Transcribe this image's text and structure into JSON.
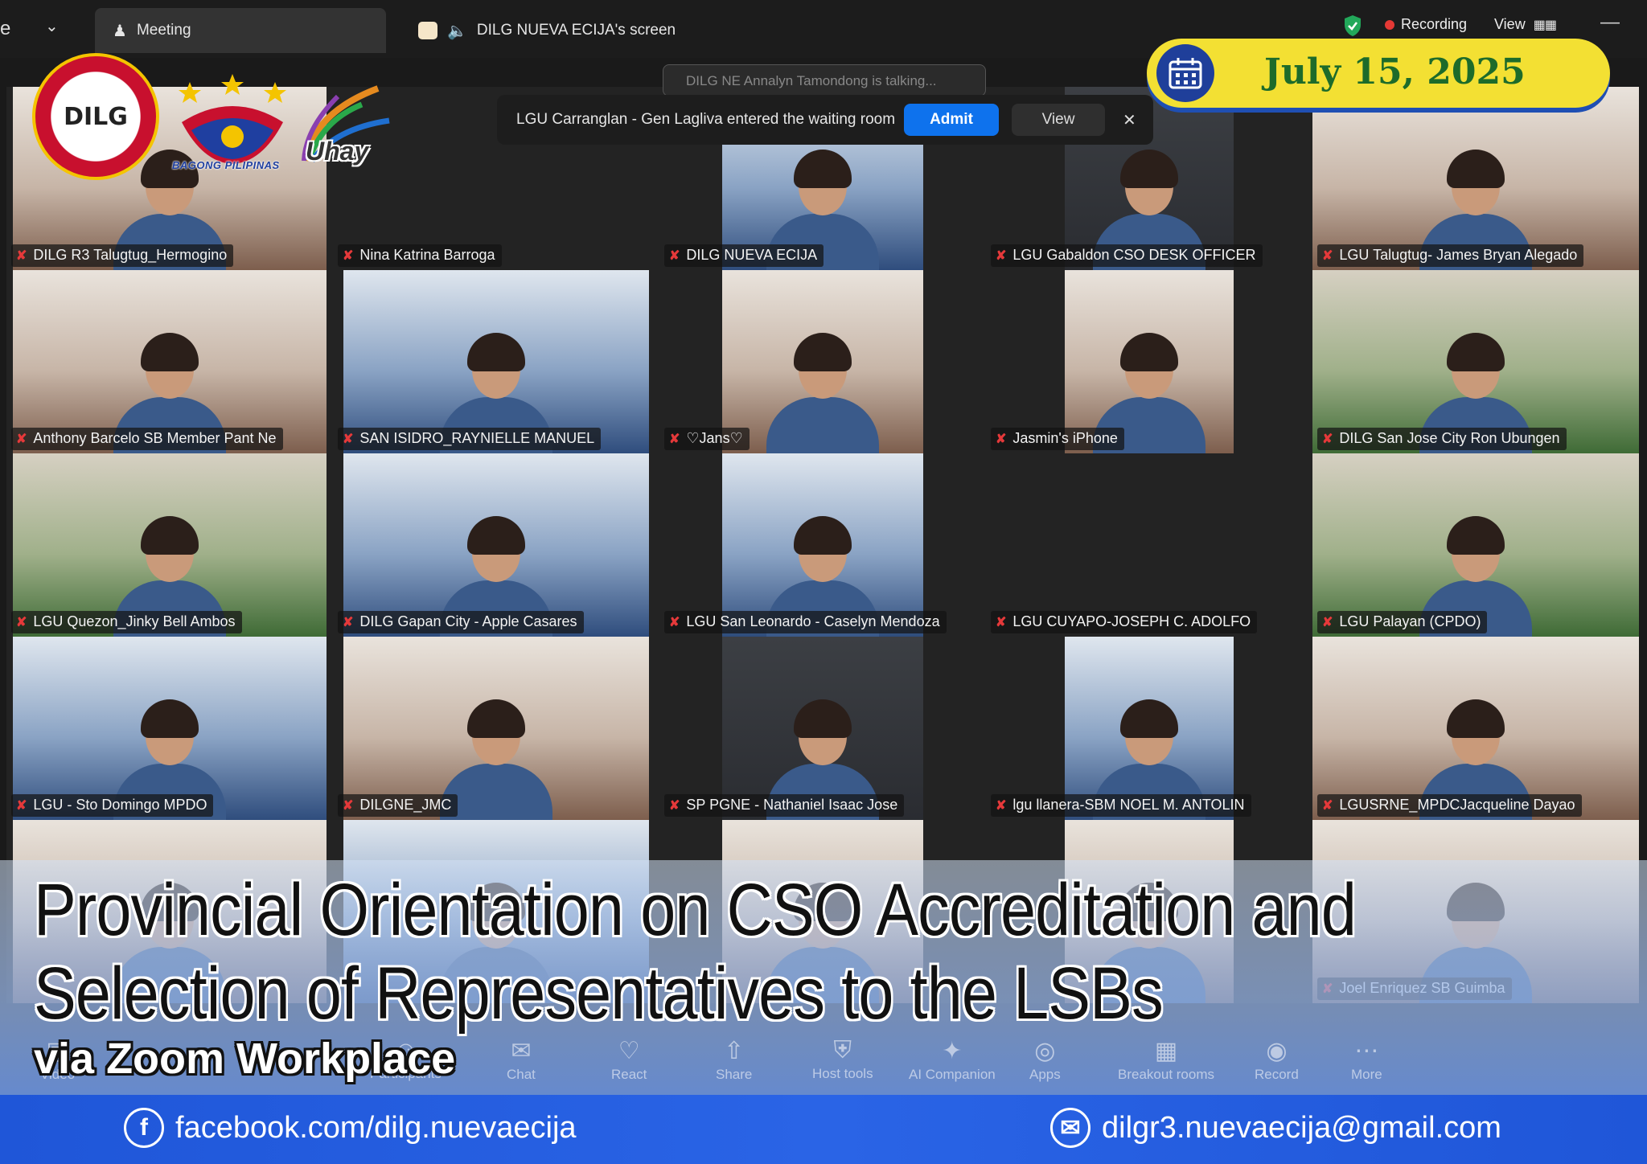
{
  "topbar": {
    "meeting_tab": "Meeting",
    "screen_tab": "DILG NUEVA ECIJA's screen",
    "recording": "Recording",
    "view": "View"
  },
  "notification": {
    "talking": "DILG NE Annalyn Tamondong is talking...",
    "message": "LGU Carranglan - Gen Lagliva entered the waiting room",
    "admit": "Admit",
    "view": "View"
  },
  "logos": {
    "dilg": "DILG",
    "bagong_pilipinas": "BAGONG PILIPINAS",
    "uhay": "Uhay"
  },
  "date": "July 15, 2025",
  "participants": [
    {
      "name": "DILG R3 Talugtug_Hermogino",
      "tone": "warm"
    },
    {
      "name": "Nina Katrina Barroga",
      "tone": "none"
    },
    {
      "name": "DILG NUEVA ECIJA",
      "tone": "blue"
    },
    {
      "name": "LGU Gabaldon CSO DESK OFFICER",
      "tone": "dark"
    },
    {
      "name": "LGU Talugtug- James Bryan Alegado",
      "tone": "warm"
    },
    {
      "name": "Anthony Barcelo SB Member Pant Ne",
      "tone": "warm"
    },
    {
      "name": "SAN ISIDRO_RAYNIELLE MANUEL",
      "tone": "blue"
    },
    {
      "name": "♡Jans♡",
      "tone": "warm"
    },
    {
      "name": "Jasmin's iPhone",
      "tone": "warm"
    },
    {
      "name": "DILG San Jose City Ron Ubungen",
      "tone": "green"
    },
    {
      "name": "LGU Quezon_Jinky Bell Ambos",
      "tone": "green"
    },
    {
      "name": "DILG Gapan City - Apple Casares",
      "tone": "blue"
    },
    {
      "name": "LGU San Leonardo - Caselyn Mendoza",
      "tone": "blue"
    },
    {
      "name": "LGU CUYAPO-JOSEPH C. ADOLFO",
      "tone": "none"
    },
    {
      "name": "LGU Palayan (CPDO)",
      "tone": "green"
    },
    {
      "name": "LGU - Sto Domingo MPDO",
      "tone": "blue"
    },
    {
      "name": "DILGNE_JMC",
      "tone": "warm"
    },
    {
      "name": "SP PGNE - Nathaniel Isaac Jose",
      "tone": "dark"
    },
    {
      "name": "lgu llanera-SBM NOEL M. ANTOLIN",
      "tone": "blue"
    },
    {
      "name": "LGUSRNE_MPDCJacqueline Dayao",
      "tone": "warm"
    },
    {
      "name": "",
      "tone": "warm"
    },
    {
      "name": "",
      "tone": "blue"
    },
    {
      "name": "",
      "tone": "warm"
    },
    {
      "name": "",
      "tone": "warm"
    },
    {
      "name": "Joel Enriquez SB Guimba",
      "tone": "warm"
    }
  ],
  "toolbar": [
    {
      "label": "Video",
      "icon": "video-icon"
    },
    {
      "label": "Participants",
      "icon": "participants-icon"
    },
    {
      "label": "Chat",
      "icon": "chat-icon"
    },
    {
      "label": "React",
      "icon": "react-icon"
    },
    {
      "label": "Share",
      "icon": "share-icon"
    },
    {
      "label": "Host tools",
      "icon": "host-tools-icon"
    },
    {
      "label": "AI Companion",
      "icon": "ai-companion-icon"
    },
    {
      "label": "Apps",
      "icon": "apps-icon"
    },
    {
      "label": "Breakout rooms",
      "icon": "breakout-rooms-icon"
    },
    {
      "label": "Record",
      "icon": "record-icon"
    },
    {
      "label": "More",
      "icon": "more-icon"
    }
  ],
  "headline": {
    "line1": "Provincial Orientation on CSO Accreditation and",
    "line2": "Selection of Representatives to the LSBs",
    "sub": "via Zoom Workplace"
  },
  "footer": {
    "facebook": "facebook.com/dilg.nuevaecija",
    "email": "dilgr3.nuevaecija@gmail.com"
  },
  "colors": {
    "accent_blue": "#0e72ed",
    "banner_yellow": "#f3e033",
    "footer_blue": "#1f56d8",
    "mic_off_red": "#e5393a"
  }
}
